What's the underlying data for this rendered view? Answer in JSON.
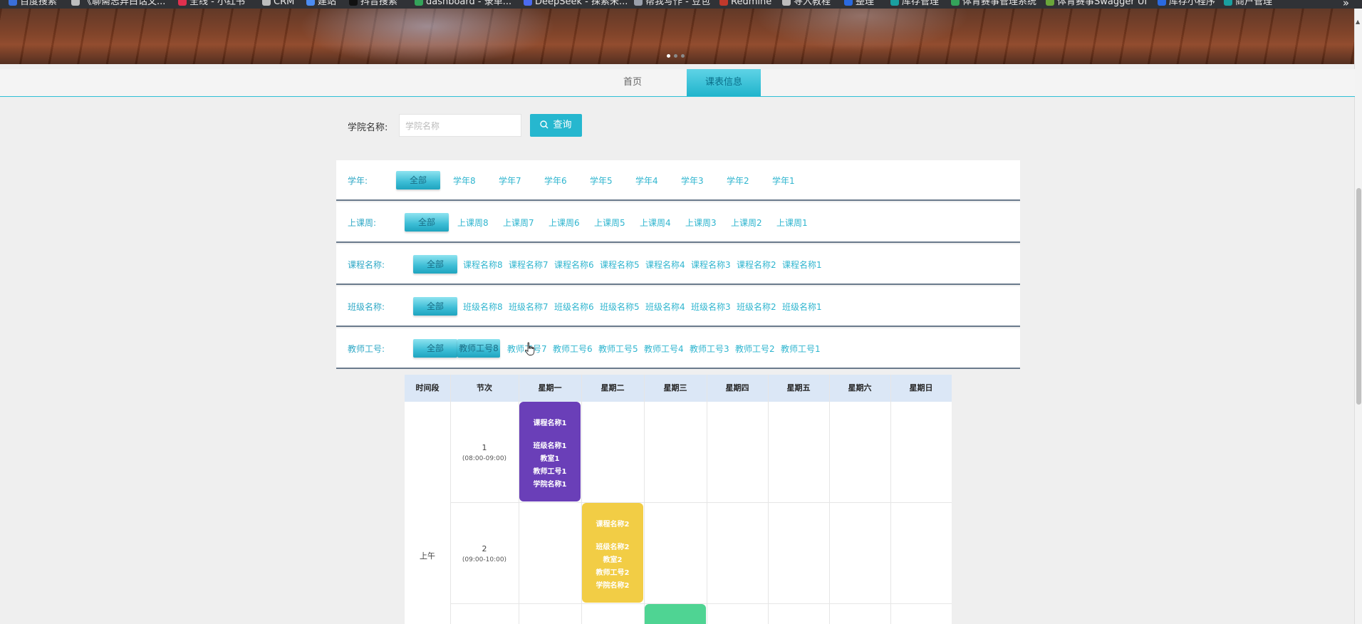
{
  "bookmarks": [
    {
      "label": "百度搜索",
      "color": "#3a6fd8"
    },
    {
      "label": "《聊斋志异白话文...",
      "color": "#bdbdbd"
    },
    {
      "label": "全线 - 小红书",
      "color": "#e0304e"
    },
    {
      "label": "CRM",
      "color": "#bdbdbd"
    },
    {
      "label": "建站",
      "color": "#4c8cf0"
    },
    {
      "label": "抖音搜索",
      "color": "#111111"
    },
    {
      "label": "dashboard - 录单...",
      "color": "#34a35a"
    },
    {
      "label": "DeepSeek - 探索未...",
      "color": "#4b6bf0"
    },
    {
      "label": "帮我写作 - 豆包",
      "color": "#9aa0ab"
    },
    {
      "label": "Redmine",
      "color": "#c0392b"
    },
    {
      "label": "导入教程",
      "color": "#bdbdbd"
    },
    {
      "label": "整理",
      "color": "#2a6ae0"
    },
    {
      "label": "库存管理",
      "color": "#1aa0a0"
    },
    {
      "label": "体育赛事管理系统",
      "color": "#34a35a"
    },
    {
      "label": "体育赛事Swagger UI",
      "color": "#6aa63a"
    },
    {
      "label": "库存小程序",
      "color": "#2a6ae0"
    },
    {
      "label": "商户管理",
      "color": "#1aa0a0"
    }
  ],
  "bookmarks_more": "»",
  "nav": {
    "home": "首页",
    "schedule": "课表信息"
  },
  "search": {
    "label": "学院名称:",
    "placeholder": "学院名称",
    "button": "查询"
  },
  "filters": [
    {
      "label": "学年:",
      "selected": "全部",
      "options": [
        "学年8",
        "学年7",
        "学年6",
        "学年5",
        "学年4",
        "学年3",
        "学年2",
        "学年1"
      ]
    },
    {
      "label": "上课周:",
      "selected": "全部",
      "options": [
        "上课周8",
        "上课周7",
        "上课周6",
        "上课周5",
        "上课周4",
        "上课周3",
        "上课周2",
        "上课周1"
      ]
    },
    {
      "label": "课程名称:",
      "selected": "全部",
      "options": [
        "课程名称8",
        "课程名称7",
        "课程名称6",
        "课程名称5",
        "课程名称4",
        "课程名称3",
        "课程名称2",
        "课程名称1"
      ]
    },
    {
      "label": "班级名称:",
      "selected": "全部",
      "options": [
        "班级名称8",
        "班级名称7",
        "班级名称6",
        "班级名称5",
        "班级名称4",
        "班级名称3",
        "班级名称2",
        "班级名称1"
      ]
    },
    {
      "label": "教师工号:",
      "selected": "全部",
      "options": [
        "教师工号8",
        "教师工号7",
        "教师工号6",
        "教师工号5",
        "教师工号4",
        "教师工号3",
        "教师工号2",
        "教师工号1"
      ]
    }
  ],
  "timetable": {
    "headers": [
      "时间段",
      "节次",
      "星期一",
      "星期二",
      "星期三",
      "星期四",
      "星期五",
      "星期六",
      "星期日"
    ],
    "period": "上午",
    "sessions": [
      {
        "num": "1",
        "time": "(08:00-09:00)"
      },
      {
        "num": "2",
        "time": "(09:00-10:00)"
      }
    ],
    "courses": [
      {
        "course": "课程名称1",
        "class": "班级名称1",
        "room": "教室1",
        "teacher": "教师工号1",
        "college": "学院名称1",
        "color": "#6a3fb8"
      },
      {
        "course": "课程名称2",
        "class": "班级名称2",
        "room": "教室2",
        "teacher": "教师工号2",
        "college": "学院名称2",
        "color": "#f2cd45"
      },
      {
        "course": "",
        "class": "",
        "room": "",
        "teacher": "",
        "college": "",
        "color": "#4fd493"
      }
    ]
  }
}
